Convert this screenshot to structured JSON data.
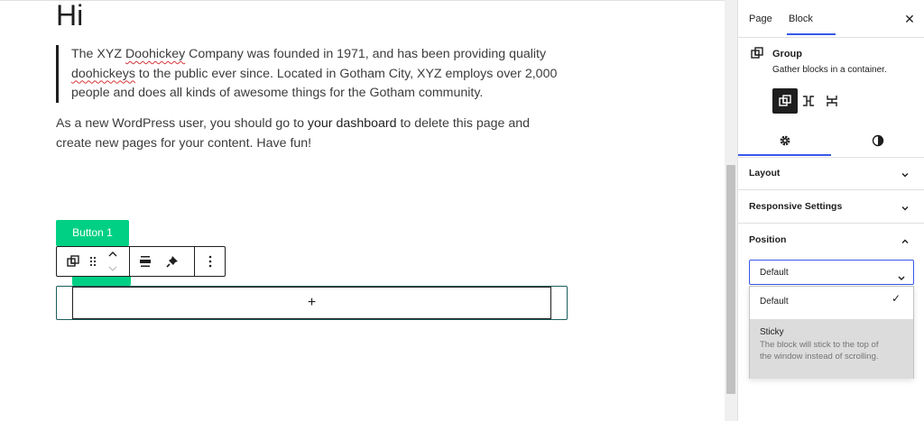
{
  "editor": {
    "heading": "Hi",
    "quote": {
      "p1": "The XYZ ",
      "w1": "Doohickey",
      "p2": " Company was founded in 1971, and has been providing quality ",
      "w2": "doohickeys",
      "p3": " to the public ever since. Located in Gotham City, XYZ employs over 2,000 people and does all kinds of awesome things for the Gotham community."
    },
    "paragraph": {
      "before": "As a new WordPress user, you should go to ",
      "link": "your dashboard",
      "after": " to delete this page and create new pages for your content. Have fun!"
    },
    "button_label": "Button 1",
    "appender_symbol": "+"
  },
  "sidebar": {
    "tabs": [
      "Page",
      "Block"
    ],
    "close_symbol": "✕",
    "block": {
      "name": "Group",
      "description": "Gather blocks in a container."
    },
    "panels": {
      "layout": "Layout",
      "responsive": "Responsive Settings",
      "position": "Position"
    },
    "position_select": {
      "value": "Default",
      "options": [
        {
          "label": "Default",
          "selected_mark": "✓"
        },
        {
          "label": "Sticky",
          "description": "The block will stick to the top of the window instead of scrolling."
        }
      ]
    }
  },
  "colors": {
    "accent": "#3858e9",
    "button_green": "#00d084",
    "text": "#1e1e1e"
  },
  "icons": {
    "toolbar": [
      "group-icon",
      "drag-handle-icon",
      "move-up-icon",
      "move-down-icon",
      "justify-icon",
      "pin-icon",
      "more-options-icon"
    ],
    "sidebar": [
      "group-icon",
      "row-icon",
      "stack-icon",
      "gear-icon",
      "contrast-icon",
      "chevron-down-icon",
      "chevron-up-icon"
    ]
  }
}
